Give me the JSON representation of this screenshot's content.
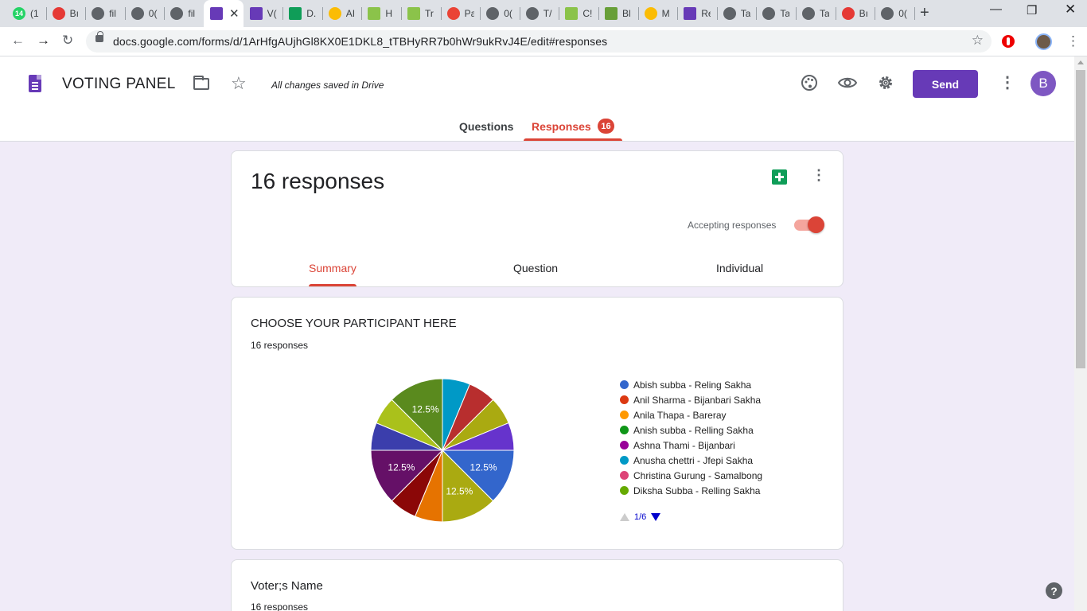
{
  "browser": {
    "tabs": [
      {
        "title": "(1",
        "icon": "whatsapp-icon",
        "color": "#25d366",
        "badge": "14"
      },
      {
        "title": "Bı",
        "icon": "swirl-icon",
        "color": "#e53935"
      },
      {
        "title": "fil",
        "icon": "globe-icon",
        "color": "#5f6368"
      },
      {
        "title": "0(",
        "icon": "globe-icon",
        "color": "#5f6368"
      },
      {
        "title": "fil",
        "icon": "globe-icon",
        "color": "#5f6368"
      },
      {
        "title": "",
        "icon": "forms-icon",
        "color": "#673ab7",
        "active": true
      },
      {
        "title": "V(",
        "icon": "forms-icon",
        "color": "#673ab7"
      },
      {
        "title": "D.",
        "icon": "sheets-icon",
        "color": "#0f9d58"
      },
      {
        "title": "AI",
        "icon": "apps-script-icon",
        "color": "#fbbc04"
      },
      {
        "title": "H",
        "icon": "w3-icon",
        "color": "#8bc34a"
      },
      {
        "title": "Tr",
        "icon": "w3-icon",
        "color": "#8bc34a"
      },
      {
        "title": "Pa",
        "icon": "gmail-icon",
        "color": "#ea4335"
      },
      {
        "title": "0(",
        "icon": "globe-icon",
        "color": "#5f6368"
      },
      {
        "title": "T/",
        "icon": "globe-icon",
        "color": "#5f6368"
      },
      {
        "title": "C!",
        "icon": "w3-icon",
        "color": "#8bc34a"
      },
      {
        "title": "Bl",
        "icon": "code-icon",
        "color": "#689f38"
      },
      {
        "title": "M",
        "icon": "drive-icon",
        "color": "#fbbc04"
      },
      {
        "title": "Re",
        "icon": "forms-icon",
        "color": "#673ab7"
      },
      {
        "title": "Ta",
        "icon": "globe-icon",
        "color": "#5f6368"
      },
      {
        "title": "Ta",
        "icon": "globe-icon",
        "color": "#5f6368"
      },
      {
        "title": "Ta",
        "icon": "globe-icon",
        "color": "#5f6368"
      },
      {
        "title": "Bı",
        "icon": "swirl-icon",
        "color": "#e53935"
      },
      {
        "title": "0(",
        "icon": "globe-icon",
        "color": "#5f6368"
      }
    ],
    "url": "docs.google.com/forms/d/1ArHfgAUjhGl8KX0E1DKL8_tTBHyRR7b0hWr9ukRvJ4E/edit#responses"
  },
  "header": {
    "title": "VOTING PANEL",
    "saved_status": "All changes saved in Drive",
    "send_label": "Send",
    "avatar_letter": "B",
    "tab_questions": "Questions",
    "tab_responses": "Responses",
    "responses_badge": "16"
  },
  "summary_card": {
    "count_label": "16 responses",
    "accepting_label": "Accepting responses",
    "accepting": true,
    "tab_summary": "Summary",
    "tab_question": "Question",
    "tab_individual": "Individual"
  },
  "question_card": {
    "title": "CHOOSE YOUR PARTICIPANT HERE",
    "responses": "16 responses",
    "pager": "1/6"
  },
  "next_card": {
    "title": "Voter;s Name",
    "responses": "16 responses"
  },
  "chart_data": {
    "type": "pie",
    "total_responses": 16,
    "legend": [
      {
        "name": "Abish subba - Reling Sakha",
        "color": "#3366cc"
      },
      {
        "name": "Anil Sharma - Bijanbari Sakha",
        "color": "#dc3912"
      },
      {
        "name": "Anila Thapa - Bareray",
        "color": "#ff9900"
      },
      {
        "name": "Anish subba - Relling Sakha",
        "color": "#109618"
      },
      {
        "name": "Ashna Thami - Bijanbari",
        "color": "#990099"
      },
      {
        "name": "Anusha chettri - Jfepi Sakha",
        "color": "#0099c6"
      },
      {
        "name": "Christina Gurung - Samalbong",
        "color": "#dd4477"
      },
      {
        "name": "Diksha Subba - Relling Sakha",
        "color": "#66aa00"
      }
    ],
    "slices": [
      {
        "value": 1,
        "color": "#0099c6"
      },
      {
        "value": 1,
        "color": "#b82e2e"
      },
      {
        "value": 1,
        "color": "#aaaa11"
      },
      {
        "value": 1,
        "color": "#6633cc"
      },
      {
        "value": 2,
        "color": "#3366cc",
        "label": "12.5%"
      },
      {
        "value": 2,
        "color": "#aaaa11",
        "label": "12.5%"
      },
      {
        "value": 1,
        "color": "#e67300"
      },
      {
        "value": 1,
        "color": "#8b0707"
      },
      {
        "value": 2,
        "color": "#651067",
        "label": "12.5%"
      },
      {
        "value": 1,
        "color": "#3b3eac"
      },
      {
        "value": 1,
        "color": "#aac11b"
      },
      {
        "value": 2,
        "color": "#5a8a1e",
        "label": "12.5%"
      }
    ]
  }
}
